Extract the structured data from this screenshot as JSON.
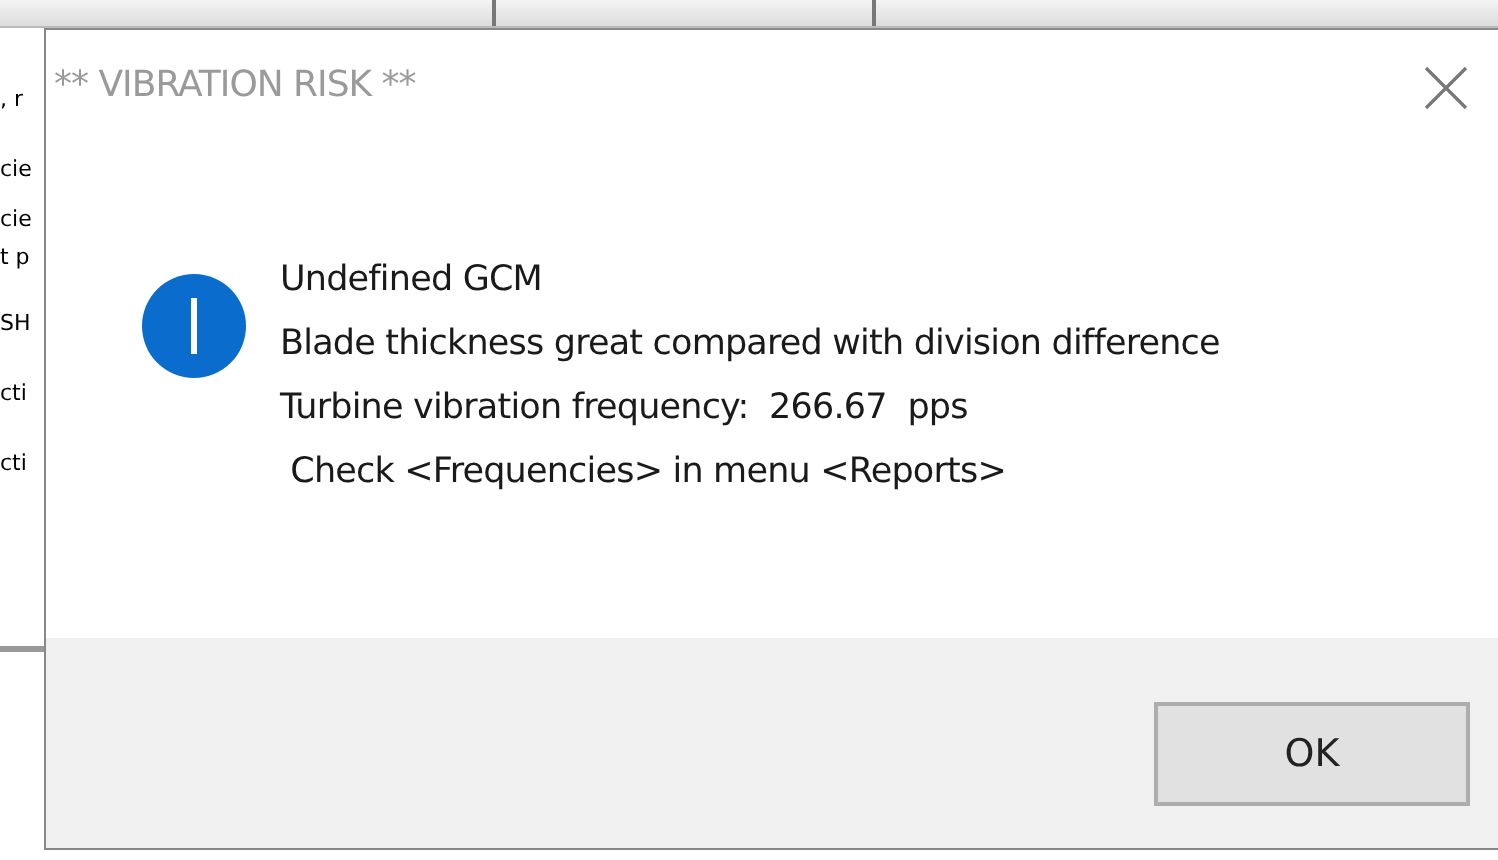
{
  "background_window": {
    "fragments": [
      ", r",
      "cie",
      "cie",
      "t p",
      "SH",
      "cti",
      "cti"
    ]
  },
  "dialog": {
    "title": "** VIBRATION RISK **",
    "message": [
      "Undefined GCM",
      "Blade thickness great compared with division difference",
      "Turbine vibration frequency:  266.67  pps",
      " Check <Frequencies> in menu <Reports>"
    ],
    "buttons": [
      "OK"
    ]
  }
}
